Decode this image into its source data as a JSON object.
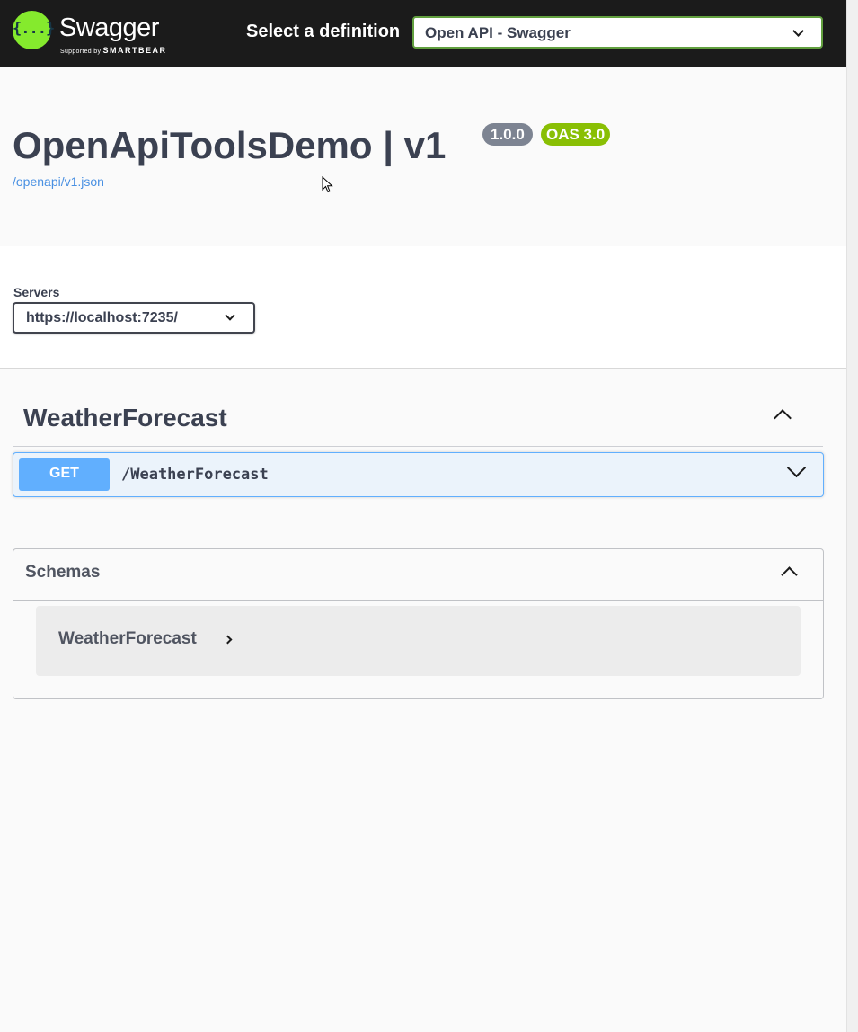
{
  "topbar": {
    "logo_word": "Swagger",
    "logo_sub_prefix": "Supported by",
    "logo_sub_brand": "SMARTBEAR",
    "logo_glyph": "{...}",
    "definition_label": "Select a definition",
    "definition_selected": "Open API - Swagger"
  },
  "info": {
    "title": "OpenApiToolsDemo | v1",
    "version_badge": "1.0.0",
    "oas_badge": "OAS 3.0",
    "spec_link": "/openapi/v1.json"
  },
  "servers": {
    "label": "Servers",
    "selected": "https://localhost:7235/"
  },
  "tags": [
    {
      "name": "WeatherForecast",
      "operations": [
        {
          "method": "GET",
          "path": "/WeatherForecast"
        }
      ]
    }
  ],
  "schemas": {
    "title": "Schemas",
    "items": [
      {
        "name": "WeatherForecast"
      }
    ]
  },
  "colors": {
    "topbar_bg": "#1b1b1b",
    "swagger_green": "#85ea2d",
    "get_blue": "#61affe",
    "oas_green": "#89bf04",
    "version_gray": "#7d8492",
    "link_blue": "#4990e2"
  }
}
